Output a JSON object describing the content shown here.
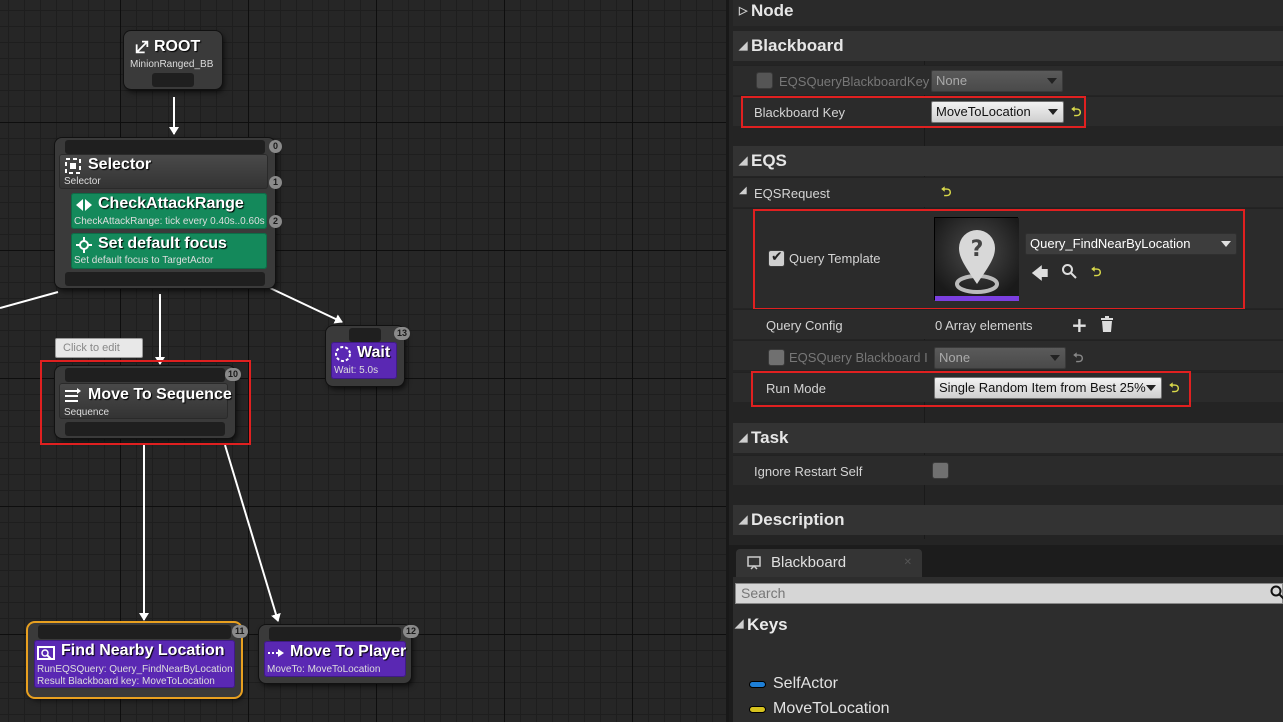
{
  "graph": {
    "root": {
      "title": "ROOT",
      "subtitle": "MinionRanged_BB"
    },
    "selector": {
      "title": "Selector",
      "subtitle": "Selector",
      "index": "0",
      "index_sub": "1",
      "service": {
        "title": "CheckAttackRange",
        "subtitle": "CheckAttackRange: tick every 0.40s..0.60s",
        "index": "2"
      },
      "focus": {
        "title": "Set default focus",
        "subtitle": "Set default focus to TargetActor"
      }
    },
    "tooltip": "Click to edit",
    "sequence": {
      "title": "Move To Sequence",
      "subtitle": "Sequence",
      "index": "10"
    },
    "wait": {
      "title": "Wait",
      "subtitle": "Wait: 5.0s",
      "index": "13"
    },
    "find": {
      "title": "Find Nearby Location",
      "line1": "RunEQSQuery: Query_FindNearByLocation",
      "line2": "Result Blackboard key: MoveToLocation",
      "index": "11"
    },
    "moveto": {
      "title": "Move To Player",
      "subtitle": "MoveTo: MoveToLocation",
      "index": "12"
    }
  },
  "details": {
    "node_category": "Node",
    "blackboard_category": "Blackboard",
    "eqs_bb_key": {
      "label": "EQSQueryBlackboardKey",
      "value": "None"
    },
    "blackboard_key": {
      "label": "Blackboard Key",
      "value": "MoveToLocation"
    },
    "eqs_category": "EQS",
    "eqs_request": {
      "label": "EQSRequest"
    },
    "query_template": {
      "label": "Query Template",
      "value": "Query_FindNearByLocation",
      "checked": true
    },
    "query_config": {
      "label": "Query Config",
      "value": "0 Array elements"
    },
    "eqs_query_bb": {
      "label": "EQSQuery Blackboard I",
      "value": "None"
    },
    "run_mode": {
      "label": "Run Mode",
      "value": "Single Random Item from Best 25%"
    },
    "task_category": "Task",
    "ignore_restart": {
      "label": "Ignore Restart Self",
      "checked": false
    },
    "description_category": "Description"
  },
  "blackboard_panel": {
    "tab_label": "Blackboard",
    "search_placeholder": "Search",
    "keys_heading": "Keys",
    "keys": [
      {
        "name": "SelfActor",
        "color": "#1e7fd6"
      },
      {
        "name": "MoveToLocation",
        "color": "#d6c21e"
      }
    ]
  },
  "colors": {
    "highlight_red": "#e02020",
    "service_green": "#14895b",
    "task_purple": "#5a28b3",
    "selected_orange": "#e8a020"
  }
}
